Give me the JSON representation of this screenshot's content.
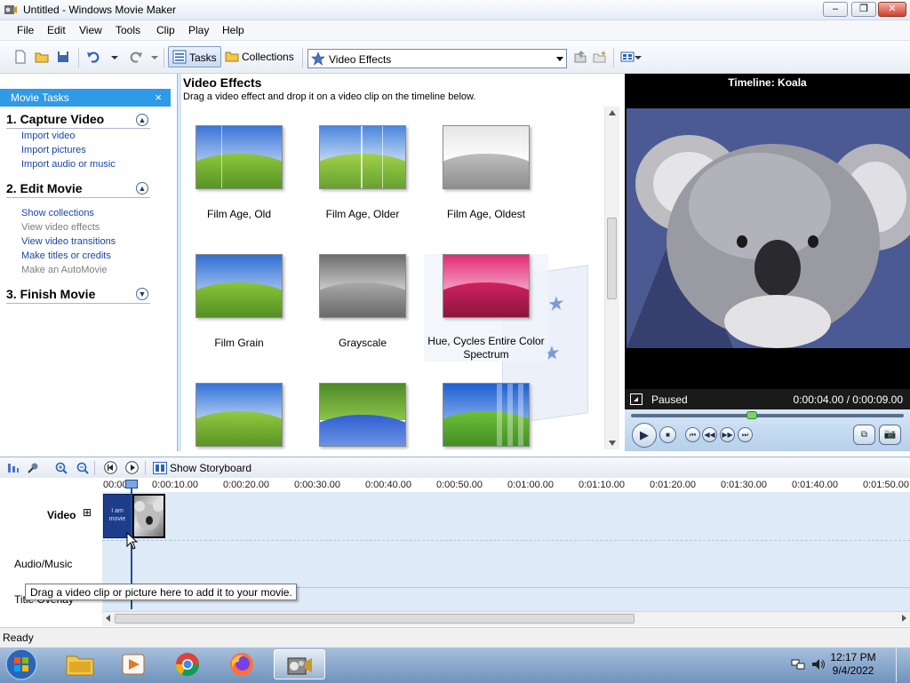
{
  "window": {
    "title": "Untitled - Windows Movie Maker",
    "minimize": "–",
    "maximize": "❐",
    "close": "✕"
  },
  "menu": [
    "File",
    "Edit",
    "View",
    "Tools",
    "Clip",
    "Play",
    "Help"
  ],
  "toolbar": {
    "tasks_label": "Tasks",
    "collections_label": "Collections",
    "effects_select": "Video Effects"
  },
  "task_pane": {
    "header": "Movie Tasks",
    "close": "×",
    "sections": [
      {
        "title": "1. Capture Video",
        "links": [
          "Import video",
          "Import pictures",
          "Import audio or music"
        ]
      },
      {
        "title": "2. Edit Movie",
        "links": [
          "Show collections",
          "View video effects",
          "View video transitions",
          "Make titles or credits",
          "Make an AutoMovie"
        ]
      },
      {
        "title": "3. Finish Movie",
        "links": []
      }
    ]
  },
  "effects": {
    "title": "Video Effects",
    "subtitle": "Drag a video effect and drop it on a video clip on the timeline below.",
    "items": [
      "Film Age, Old",
      "Film Age, Older",
      "Film Age, Oldest",
      "Film Grain",
      "Grayscale",
      "Hue, Cycles Entire Color Spectrum",
      "",
      "",
      ""
    ]
  },
  "preview": {
    "title": "Timeline: Koala",
    "state": "Paused",
    "time": "0:00:04.00 / 0:00:09.00",
    "seek_fraction": 0.44
  },
  "timeline": {
    "storyboard_label": "Show Storyboard",
    "ticks": [
      "00:00",
      "0:00:10.00",
      "0:00:20.00",
      "0:00:30.00",
      "0:00:40.00",
      "0:00:50.00",
      "0:01:00.00",
      "0:01:10.00",
      "0:01:20.00",
      "0:01:30.00",
      "0:01:40.00",
      "0:01:50.00"
    ],
    "tracks": {
      "video": "Video",
      "video_expand": "⊞",
      "audio": "Audio/Music",
      "title": "Title Overlay"
    },
    "clip1_text": "I am movie",
    "tooltip": "Drag a video clip or picture here to add it to your movie."
  },
  "status": "Ready",
  "taskbar": {
    "time": "12:17 PM",
    "date": "9/4/2022"
  }
}
